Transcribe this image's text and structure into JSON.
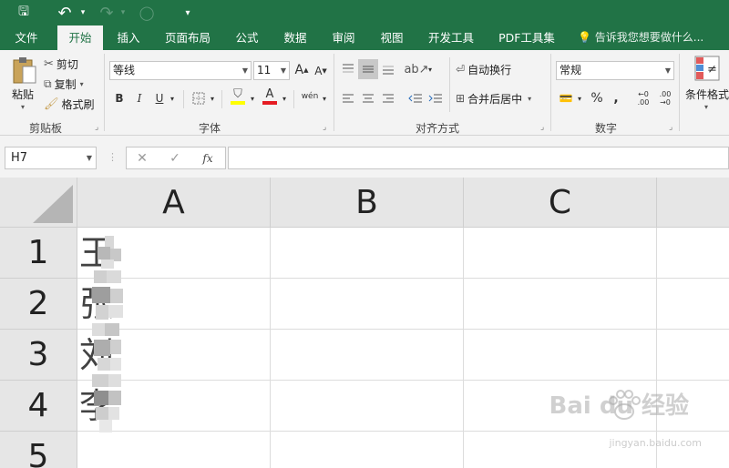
{
  "titlebar": {
    "icons": [
      "save-icon",
      "undo-icon",
      "redo-icon",
      "touch-mode-icon",
      "customize-qat-icon"
    ],
    "save_glyph": "🖫",
    "undo_glyph": "↶",
    "redo_glyph": "↷",
    "touch_glyph": "◯",
    "customize_glyph": "▾"
  },
  "ribbon_tabs": [
    "文件",
    "开始",
    "插入",
    "页面布局",
    "公式",
    "数据",
    "审阅",
    "视图",
    "开发工具",
    "PDF工具集"
  ],
  "active_tab": "开始",
  "tell_me": "告诉我您想要做什么...",
  "clipboard": {
    "paste": "粘贴",
    "cut": "剪切",
    "copy": "复制",
    "format_painter": "格式刷",
    "label": "剪贴板"
  },
  "font": {
    "name": "等线",
    "size": "11",
    "grow": "A",
    "shrink": "A",
    "bold": "B",
    "italic": "I",
    "underline": "U",
    "font_color_glyph": "A",
    "phonetic": "wén",
    "label": "字体"
  },
  "alignment": {
    "wrap_text": "自动换行",
    "merge_center": "合并后居中",
    "label": "对齐方式"
  },
  "number": {
    "format": "常规",
    "percent": "%",
    "comma": ",",
    "increase_decimal": "←0 .00",
    "decrease_decimal": ".00 →0",
    "label": "数字"
  },
  "styles": {
    "conditional_formatting": "条件格式"
  },
  "formula_bar": {
    "name_box": "H7",
    "cancel_glyph": "✕",
    "enter_glyph": "✓",
    "fx": "fx",
    "formula": ""
  },
  "grid": {
    "columns": [
      "A",
      "B",
      "C"
    ],
    "rows": [
      "1",
      "2",
      "3",
      "4",
      "5"
    ],
    "cells": [
      {
        "ref": "A1",
        "text": "王"
      },
      {
        "ref": "A2",
        "text": "张"
      },
      {
        "ref": "A3",
        "text": "刘"
      },
      {
        "ref": "A4",
        "text": "李"
      }
    ]
  },
  "watermark": {
    "brand": "Bai du 经验",
    "url": "jingyan.baidu.com"
  },
  "colors": {
    "excel_green": "#217346",
    "ribbon_bg": "#f3f3f3",
    "header_bg": "#e6e6e6"
  }
}
